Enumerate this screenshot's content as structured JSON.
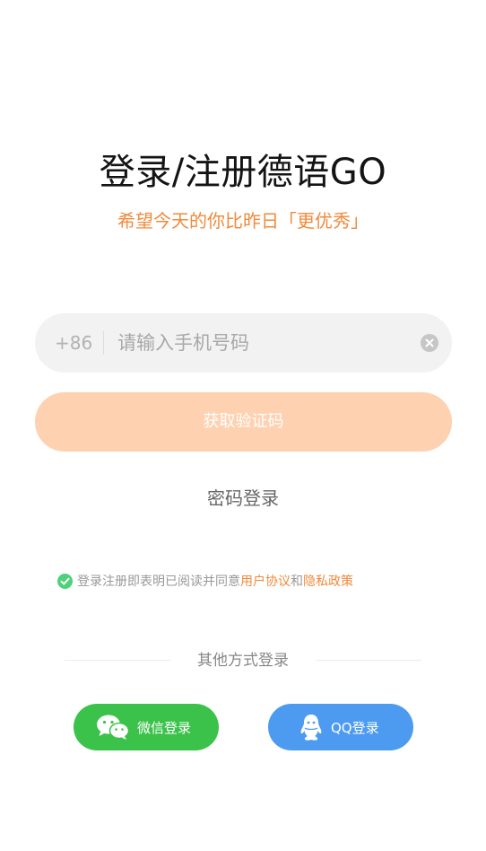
{
  "header": {
    "title": "登录/注册德语GO",
    "subtitle": "希望今天的你比昨日「更优秀」"
  },
  "phone": {
    "country_code": "+86",
    "placeholder": "请输入手机号码",
    "value": ""
  },
  "actions": {
    "get_code_label": "获取验证码",
    "password_login_label": "密码登录"
  },
  "agreement": {
    "prefix": "登录注册即表明已阅读并同意",
    "user_agreement": "用户协议",
    "conjunction": "和",
    "privacy_policy": "隐私政策",
    "checked": true
  },
  "other_login": {
    "title": "其他方式登录",
    "wechat_label": "微信登录",
    "qq_label": "QQ登录"
  },
  "colors": {
    "accent": "#f08a3c",
    "button_disabled": "#fed1b1",
    "wechat_green": "#3bc24a",
    "qq_blue": "#4d9bf1",
    "check_green": "#4fd07a"
  },
  "icons": {
    "clear": "clear-icon",
    "check": "check-icon",
    "wechat": "wechat-icon",
    "qq": "qq-icon"
  }
}
